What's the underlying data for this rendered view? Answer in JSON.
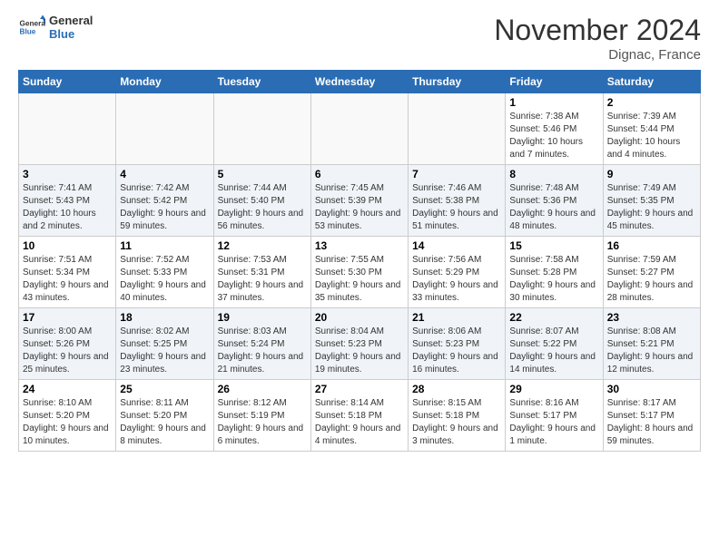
{
  "logo": {
    "general": "General",
    "blue": "Blue"
  },
  "header": {
    "month": "November 2024",
    "location": "Dignac, France"
  },
  "weekdays": [
    "Sunday",
    "Monday",
    "Tuesday",
    "Wednesday",
    "Thursday",
    "Friday",
    "Saturday"
  ],
  "weeks": [
    [
      {
        "day": "",
        "info": ""
      },
      {
        "day": "",
        "info": ""
      },
      {
        "day": "",
        "info": ""
      },
      {
        "day": "",
        "info": ""
      },
      {
        "day": "",
        "info": ""
      },
      {
        "day": "1",
        "info": "Sunrise: 7:38 AM\nSunset: 5:46 PM\nDaylight: 10 hours and 7 minutes."
      },
      {
        "day": "2",
        "info": "Sunrise: 7:39 AM\nSunset: 5:44 PM\nDaylight: 10 hours and 4 minutes."
      }
    ],
    [
      {
        "day": "3",
        "info": "Sunrise: 7:41 AM\nSunset: 5:43 PM\nDaylight: 10 hours and 2 minutes."
      },
      {
        "day": "4",
        "info": "Sunrise: 7:42 AM\nSunset: 5:42 PM\nDaylight: 9 hours and 59 minutes."
      },
      {
        "day": "5",
        "info": "Sunrise: 7:44 AM\nSunset: 5:40 PM\nDaylight: 9 hours and 56 minutes."
      },
      {
        "day": "6",
        "info": "Sunrise: 7:45 AM\nSunset: 5:39 PM\nDaylight: 9 hours and 53 minutes."
      },
      {
        "day": "7",
        "info": "Sunrise: 7:46 AM\nSunset: 5:38 PM\nDaylight: 9 hours and 51 minutes."
      },
      {
        "day": "8",
        "info": "Sunrise: 7:48 AM\nSunset: 5:36 PM\nDaylight: 9 hours and 48 minutes."
      },
      {
        "day": "9",
        "info": "Sunrise: 7:49 AM\nSunset: 5:35 PM\nDaylight: 9 hours and 45 minutes."
      }
    ],
    [
      {
        "day": "10",
        "info": "Sunrise: 7:51 AM\nSunset: 5:34 PM\nDaylight: 9 hours and 43 minutes."
      },
      {
        "day": "11",
        "info": "Sunrise: 7:52 AM\nSunset: 5:33 PM\nDaylight: 9 hours and 40 minutes."
      },
      {
        "day": "12",
        "info": "Sunrise: 7:53 AM\nSunset: 5:31 PM\nDaylight: 9 hours and 37 minutes."
      },
      {
        "day": "13",
        "info": "Sunrise: 7:55 AM\nSunset: 5:30 PM\nDaylight: 9 hours and 35 minutes."
      },
      {
        "day": "14",
        "info": "Sunrise: 7:56 AM\nSunset: 5:29 PM\nDaylight: 9 hours and 33 minutes."
      },
      {
        "day": "15",
        "info": "Sunrise: 7:58 AM\nSunset: 5:28 PM\nDaylight: 9 hours and 30 minutes."
      },
      {
        "day": "16",
        "info": "Sunrise: 7:59 AM\nSunset: 5:27 PM\nDaylight: 9 hours and 28 minutes."
      }
    ],
    [
      {
        "day": "17",
        "info": "Sunrise: 8:00 AM\nSunset: 5:26 PM\nDaylight: 9 hours and 25 minutes."
      },
      {
        "day": "18",
        "info": "Sunrise: 8:02 AM\nSunset: 5:25 PM\nDaylight: 9 hours and 23 minutes."
      },
      {
        "day": "19",
        "info": "Sunrise: 8:03 AM\nSunset: 5:24 PM\nDaylight: 9 hours and 21 minutes."
      },
      {
        "day": "20",
        "info": "Sunrise: 8:04 AM\nSunset: 5:23 PM\nDaylight: 9 hours and 19 minutes."
      },
      {
        "day": "21",
        "info": "Sunrise: 8:06 AM\nSunset: 5:23 PM\nDaylight: 9 hours and 16 minutes."
      },
      {
        "day": "22",
        "info": "Sunrise: 8:07 AM\nSunset: 5:22 PM\nDaylight: 9 hours and 14 minutes."
      },
      {
        "day": "23",
        "info": "Sunrise: 8:08 AM\nSunset: 5:21 PM\nDaylight: 9 hours and 12 minutes."
      }
    ],
    [
      {
        "day": "24",
        "info": "Sunrise: 8:10 AM\nSunset: 5:20 PM\nDaylight: 9 hours and 10 minutes."
      },
      {
        "day": "25",
        "info": "Sunrise: 8:11 AM\nSunset: 5:20 PM\nDaylight: 9 hours and 8 minutes."
      },
      {
        "day": "26",
        "info": "Sunrise: 8:12 AM\nSunset: 5:19 PM\nDaylight: 9 hours and 6 minutes."
      },
      {
        "day": "27",
        "info": "Sunrise: 8:14 AM\nSunset: 5:18 PM\nDaylight: 9 hours and 4 minutes."
      },
      {
        "day": "28",
        "info": "Sunrise: 8:15 AM\nSunset: 5:18 PM\nDaylight: 9 hours and 3 minutes."
      },
      {
        "day": "29",
        "info": "Sunrise: 8:16 AM\nSunset: 5:17 PM\nDaylight: 9 hours and 1 minute."
      },
      {
        "day": "30",
        "info": "Sunrise: 8:17 AM\nSunset: 5:17 PM\nDaylight: 8 hours and 59 minutes."
      }
    ]
  ]
}
